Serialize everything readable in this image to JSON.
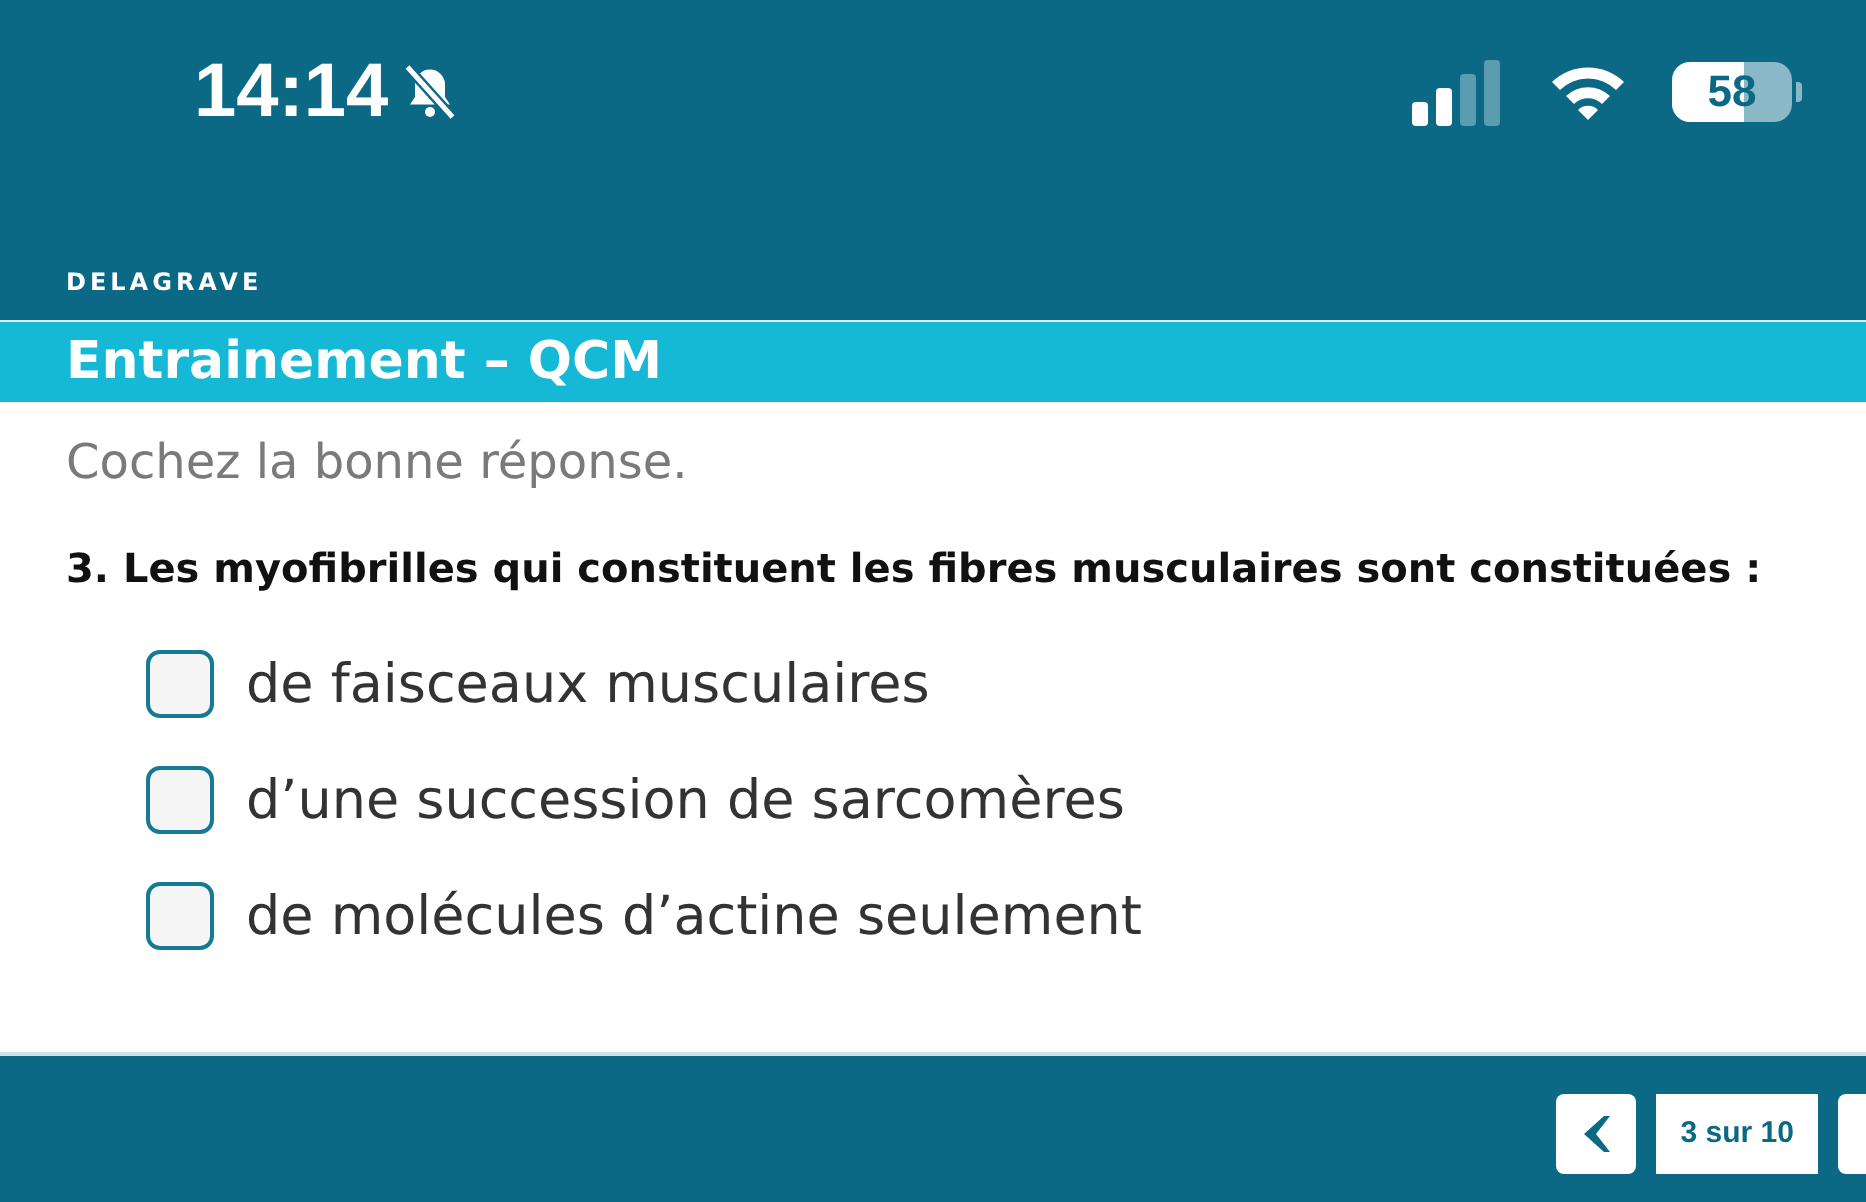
{
  "status_bar": {
    "time": "14:14",
    "silent": true,
    "battery": "58"
  },
  "publisher": "DELAGRAVE",
  "title": "Entrainement – QCM",
  "instruction": "Cochez la bonne réponse.",
  "question": "3. Les myofibrilles qui constituent les fibres musculaires sont constituées :",
  "options": [
    {
      "label": "de faisceaux musculaires",
      "checked": false
    },
    {
      "label": "d’une succession de sarcomères",
      "checked": false
    },
    {
      "label": "de molécules d’actine seulement",
      "checked": false
    }
  ],
  "pager": {
    "label": "3 sur 10"
  }
}
